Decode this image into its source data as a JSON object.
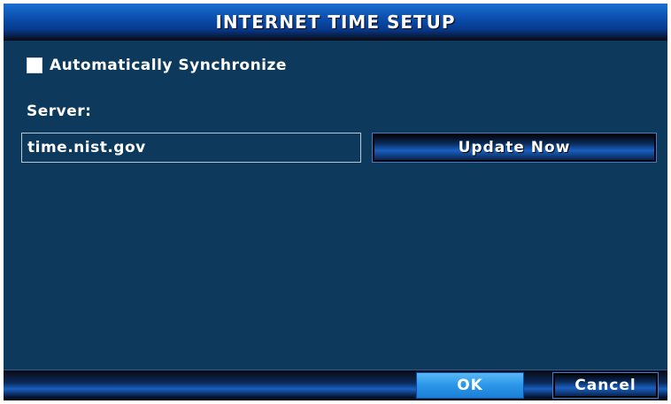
{
  "dialog": {
    "title": "INTERNET TIME SETUP"
  },
  "auto_sync": {
    "label": "Automatically Synchronize",
    "checked": false
  },
  "server": {
    "label": "Server:",
    "value": "time.nist.gov"
  },
  "buttons": {
    "update_now": "Update Now",
    "ok": "OK",
    "cancel": "Cancel"
  },
  "colors": {
    "panel_background": "#0d3a5c",
    "title_bar": "#0a4aa8",
    "ok_button": "#2a96ea"
  }
}
